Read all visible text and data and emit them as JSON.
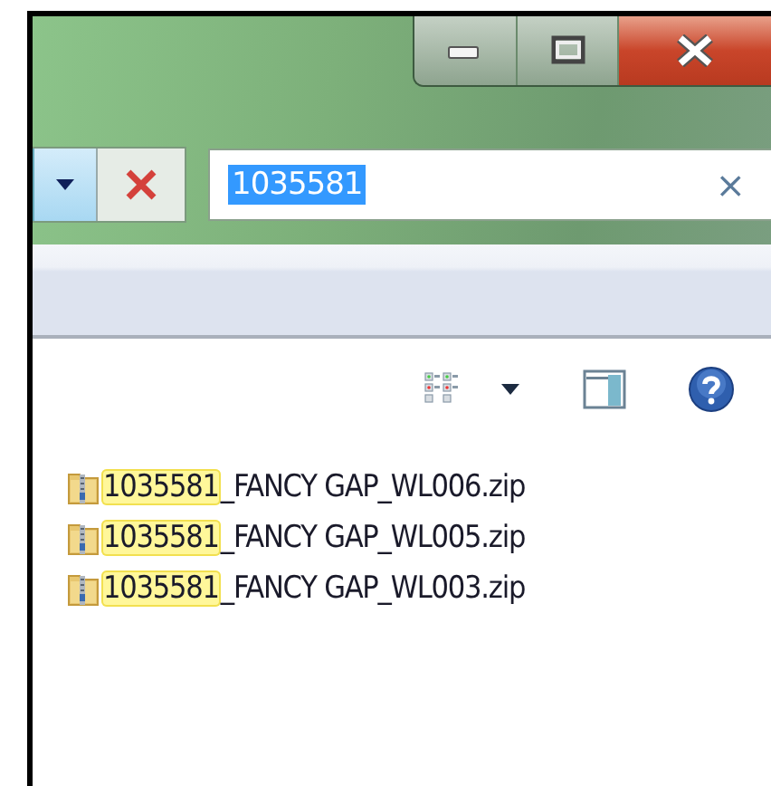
{
  "address_bar": {
    "dropdown_hovered": true
  },
  "search": {
    "value": "1035581",
    "selected": true,
    "clear": "×"
  },
  "files": [
    {
      "matched": "1035581",
      "rest": "_FANCY GAP_WL006.zip"
    },
    {
      "matched": "1035581",
      "rest": "_FANCY GAP_WL005.zip"
    },
    {
      "matched": "1035581",
      "rest": "_FANCY GAP_WL003.zip"
    }
  ]
}
